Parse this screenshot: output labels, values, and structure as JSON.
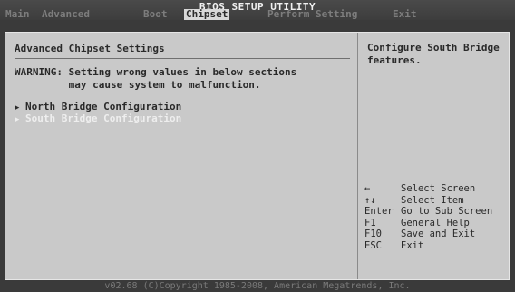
{
  "bios": {
    "title": "BIOS SETUP UTILITY",
    "tabs": [
      {
        "label": "Main"
      },
      {
        "label": "Advanced"
      },
      {
        "label": "Boot"
      },
      {
        "label": "Chipset"
      },
      {
        "label": "Perform Setting"
      },
      {
        "label": "Exit"
      }
    ],
    "active_tab": "Chipset"
  },
  "left": {
    "heading": "Advanced Chipset Settings",
    "warning_lines": [
      "WARNING: Setting wrong values in below sections",
      "         may cause system to malfunction."
    ],
    "items": [
      {
        "label": "North Bridge Configuration",
        "arrow": "▶"
      },
      {
        "label": "South Bridge Configuration",
        "arrow": "▶"
      }
    ],
    "selected_item": "South Bridge Configuration"
  },
  "right": {
    "help_text": "Configure South Bridge features.",
    "keys": [
      {
        "key": "←",
        "desc": "Select Screen"
      },
      {
        "key": "↑↓",
        "desc": "Select Item"
      },
      {
        "key": "Enter",
        "desc": "Go to Sub Screen"
      },
      {
        "key": "F1",
        "desc": "General Help"
      },
      {
        "key": "F10",
        "desc": "Save and Exit"
      },
      {
        "key": "ESC",
        "desc": "Exit"
      }
    ]
  },
  "footer": "v02.68 (C)Copyright 1985-2008, American Megatrends, Inc.",
  "colors": {
    "panel": "#c9c9c9",
    "background": "#3a3a3a",
    "selected_text": "#eeeeee",
    "normal_text": "#2a2a2a"
  }
}
